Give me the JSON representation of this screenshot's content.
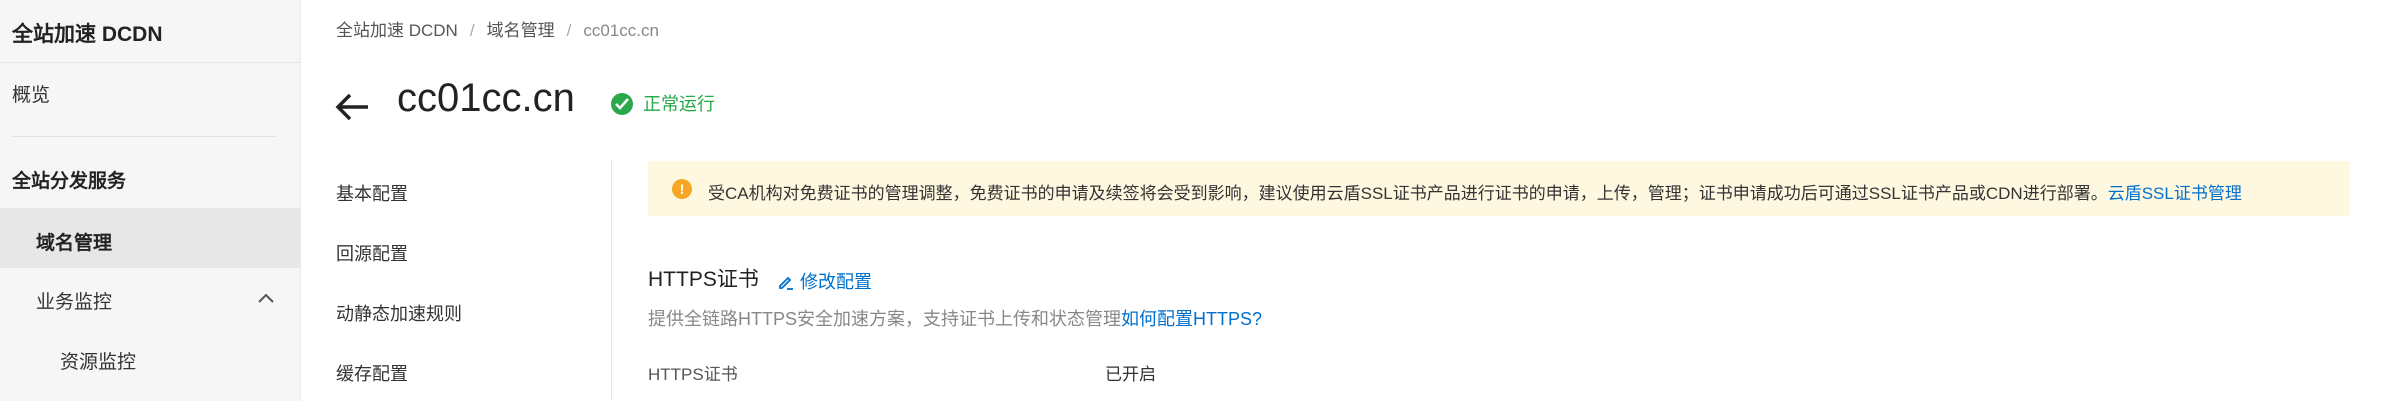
{
  "sidebar": {
    "product_title": "全站加速 DCDN",
    "overview": "概览",
    "group_title": "全站分发服务",
    "active_item": "域名管理",
    "monitor_item": "业务监控",
    "resource_item": "资源监控"
  },
  "breadcrumb": {
    "root": "全站加速 DCDN",
    "sep1": "/",
    "section": "域名管理",
    "sep2": "/",
    "current": "cc01cc.cn"
  },
  "header": {
    "domain": "cc01cc.cn",
    "status": "正常运行",
    "status_color": "#27a94a"
  },
  "config_nav": [
    "基本配置",
    "回源配置",
    "动静态加速规则",
    "缓存配置"
  ],
  "notice": {
    "text": "受CA机构对免费证书的管理调整，免费证书的申请及续签将会受到影响，建议使用云盾SSL证书产品进行证书的申请，上传，管理；证书申请成功后可通过SSL证书产品或CDN进行部署。",
    "link": "云盾SSL证书管理"
  },
  "https": {
    "title": "HTTPS证书",
    "edit_label": "修改配置",
    "desc": "提供全链路HTTPS安全加速方案，支持证书上传和状态管理",
    "desc_link": "如何配置HTTPS?",
    "field_label": "HTTPS证书",
    "field_value": "已开启"
  },
  "colors": {
    "link": "#0070cc",
    "notice_bg": "#fff8e1",
    "warning": "#f5a623"
  }
}
